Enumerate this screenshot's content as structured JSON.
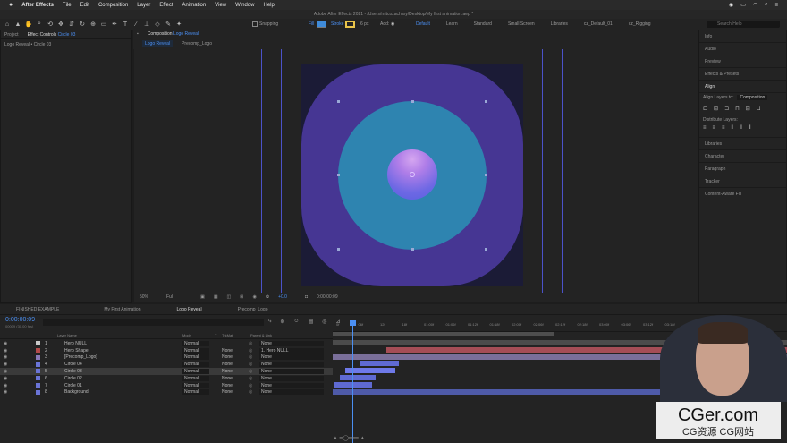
{
  "menu": {
    "app": "After Effects",
    "items": [
      "File",
      "Edit",
      "Composition",
      "Layer",
      "Effect",
      "Animation",
      "View",
      "Window",
      "Help"
    ]
  },
  "window_title": "Adobe After Effects 2021 - /Users/mitcozachary/Desktop/My first animation.aep *",
  "toolbar": {
    "snapping": "Snapping",
    "fill": "Fill",
    "stroke": "Stroke",
    "px": "6 px",
    "add": "Add:"
  },
  "workspaces": [
    "Default",
    "Learn",
    "Standard",
    "Small Screen",
    "Libraries",
    "cz_Default_01",
    "cz_Rigging"
  ],
  "search_placeholder": "Search Help",
  "left_panel": {
    "tab_project": "Project",
    "tab_effect": "Effect Controls",
    "tab_effect_target": "Circle 03",
    "subtitle": "Logo Reveal • Circle 03"
  },
  "comp_panel": {
    "tab": "Composition",
    "tab_target": "Logo Reveal",
    "subtabs": [
      "Logo Reveal",
      "Precomp_Logo"
    ]
  },
  "comp_footer": {
    "zoom": "50%",
    "quality": "Full",
    "offset": "+0.0",
    "time": "0:00:00:09"
  },
  "right_panel": {
    "items": [
      "Info",
      "Audio",
      "Preview",
      "Effects & Presets",
      "Align",
      "Libraries",
      "Character",
      "Paragraph",
      "Tracker",
      "Content-Aware Fill"
    ],
    "align_layers_to": "Align Layers to:",
    "align_target": "Composition",
    "distribute": "Distribute Layers:"
  },
  "timeline": {
    "tabs": [
      "FINISHED EXAMPLE",
      "My First Animation",
      "Logo Reveal",
      "Precomp_Logo"
    ],
    "timecode": "0:00:00:09",
    "timecode_sub": "00009 (30.00 fps)",
    "col_layer": "Layer Name",
    "col_mode": "Mode",
    "col_t": "T",
    "col_trkmat": "TrkMat",
    "col_parent": "Parent & Link",
    "ruler": [
      "0f",
      "06f",
      "12f",
      "18f",
      "01:00f",
      "01:06f",
      "01:12f",
      "01:18f",
      "02:00f",
      "02:06f",
      "02:12f",
      "02:18f",
      "03:00f",
      "03:06f",
      "03:12f",
      "03:18f",
      "04:00f"
    ],
    "layers": [
      {
        "num": "1",
        "name": "Hero NULL",
        "mode": "Normal",
        "trkmat": "",
        "parent": "None",
        "color": "#c9c9c9"
      },
      {
        "num": "2",
        "name": "Hero Shape",
        "mode": "Normal",
        "trkmat": "None",
        "parent": "1. Hero NULL",
        "color": "#b24a4a"
      },
      {
        "num": "3",
        "name": "[Precomp_Logo]",
        "mode": "Normal",
        "trkmat": "None",
        "parent": "None",
        "color": "#8a7ab8"
      },
      {
        "num": "4",
        "name": "Circle 04",
        "mode": "Normal",
        "trkmat": "None",
        "parent": "None",
        "color": "#6a74d6"
      },
      {
        "num": "5",
        "name": "Circle 03",
        "mode": "Normal",
        "trkmat": "None",
        "parent": "None",
        "color": "#6a74d6"
      },
      {
        "num": "6",
        "name": "Circle 02",
        "mode": "Normal",
        "trkmat": "None",
        "parent": "None",
        "color": "#6a74d6"
      },
      {
        "num": "7",
        "name": "Circle 01",
        "mode": "Normal",
        "trkmat": "None",
        "parent": "None",
        "color": "#6a74d6"
      },
      {
        "num": "8",
        "name": "Background",
        "mode": "Normal",
        "trkmat": "None",
        "parent": "None",
        "color": "#6a74d6"
      }
    ]
  },
  "watermark": {
    "main": "CGer.com",
    "sub": "CG资源 CG网站"
  },
  "colors": {
    "accent": "#4b8ff2",
    "canvas_bg": "#463693",
    "circle": "#2e84b0",
    "ball_top": "#b07ee8",
    "ball_bottom": "#5a5fe0"
  }
}
